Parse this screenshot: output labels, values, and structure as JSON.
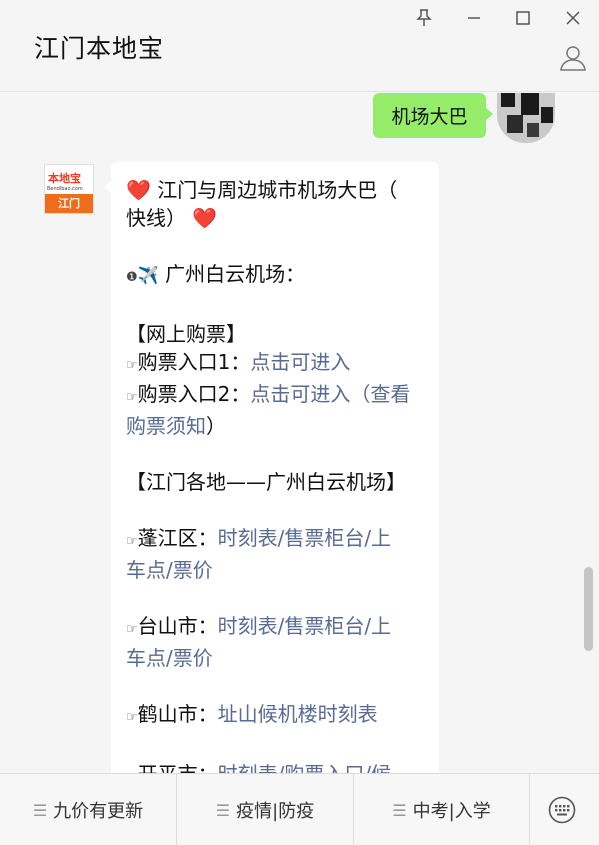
{
  "window": {
    "title": "江门本地宝",
    "pin_icon": "pin-icon",
    "minimize_icon": "minimize-icon",
    "maximize_icon": "maximize-icon",
    "close_icon": "close-icon",
    "profile_icon": "profile-icon"
  },
  "chat": {
    "outgoing": {
      "text": "机场大巴"
    },
    "bot_avatar": {
      "brand": "本地宝",
      "site": "Bendibao.com",
      "city": "江门"
    },
    "message": {
      "title_line1": "江门与周边城市机场大巴（",
      "title_line2": "快线）",
      "heart": "❤️",
      "plane_prefix": "❶",
      "plane": "✈️",
      "airport": " 广州白云机场：",
      "section_online": "【网上购票】",
      "pointer": "☞",
      "entry1_label": "购票入口1：",
      "entry1_link": "点击可进入",
      "entry2_label": "购票入口2：",
      "entry2_link": "点击可进入",
      "entry2_open": "（",
      "entry2_notice_a": "查看",
      "entry2_notice_b": "购票须知",
      "entry2_close": "）",
      "section_route": "【江门各地——广州白云机场】",
      "pengjiang_label": "蓬江区：",
      "pengjiang_link_a": "时刻表/售票柜台/上",
      "pengjiang_link_b": "车点/票价",
      "taishan_label": "台山市：",
      "taishan_link_a": "时刻表/售票柜台/上",
      "taishan_link_b": "车点/票价",
      "heshan_label": "鹤山市：",
      "heshan_link": "址山候机楼时刻表",
      "kaiping_label": "开平市：",
      "kaiping_link": "时刻表/购票入口/候"
    }
  },
  "footer": {
    "menu": [
      {
        "label": "九价有更新"
      },
      {
        "label": "疫情|防疫"
      },
      {
        "label": "中考|入学"
      }
    ],
    "menu_icon": "menu-lines-icon",
    "keyboard_icon": "keyboard-icon"
  }
}
